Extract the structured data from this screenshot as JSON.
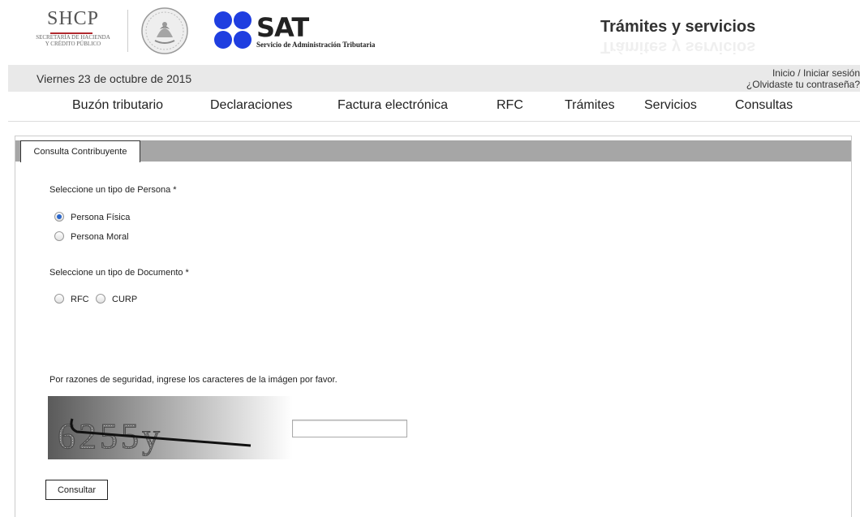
{
  "header": {
    "shcp_logo": {
      "acronym": "SHCP",
      "line1": "SECRETARÍA DE HACIENDA",
      "line2": "Y CRÉDITO PÚBLICO"
    },
    "sat_logo": {
      "name": "SAT",
      "subtitle": "Servicio de Administración Tributaria",
      "color": "#1f3ee0"
    },
    "seal_icon": "mexican-coat-of-arms-icon",
    "title": "Trámites y servicios"
  },
  "datebar": {
    "date": "Viernes 23 de octubre de 2015",
    "links": {
      "inicio": "Inicio",
      "sep": " / ",
      "login": "Iniciar sesión",
      "forgot": "¿Olvidaste tu contraseña?"
    }
  },
  "nav": {
    "items": [
      "Buzón tributario",
      "Declaraciones",
      "Factura electrónica",
      "RFC",
      "Trámites",
      "Servicios",
      "Consultas"
    ]
  },
  "panel": {
    "tab": "Consulta Contribuyente",
    "persona_label": "Seleccione un tipo de Persona *",
    "persona_options": [
      {
        "label": "Persona Física",
        "selected": true
      },
      {
        "label": "Persona Moral",
        "selected": false
      }
    ],
    "documento_label": "Seleccione un tipo de Documento *",
    "documento_options": [
      {
        "label": "RFC",
        "selected": false
      },
      {
        "label": "CURP",
        "selected": false
      }
    ],
    "captcha_label": "Por razones de seguridad, ingrese los caracteres de la imágen por favor.",
    "captcha_text": "6255y",
    "captcha_input_value": "",
    "submit_label": "Consultar"
  },
  "colors": {
    "tabstrip": "#a6a6a6",
    "datebar": "#e9e9e9",
    "radio_selected": "#2a66c9"
  }
}
